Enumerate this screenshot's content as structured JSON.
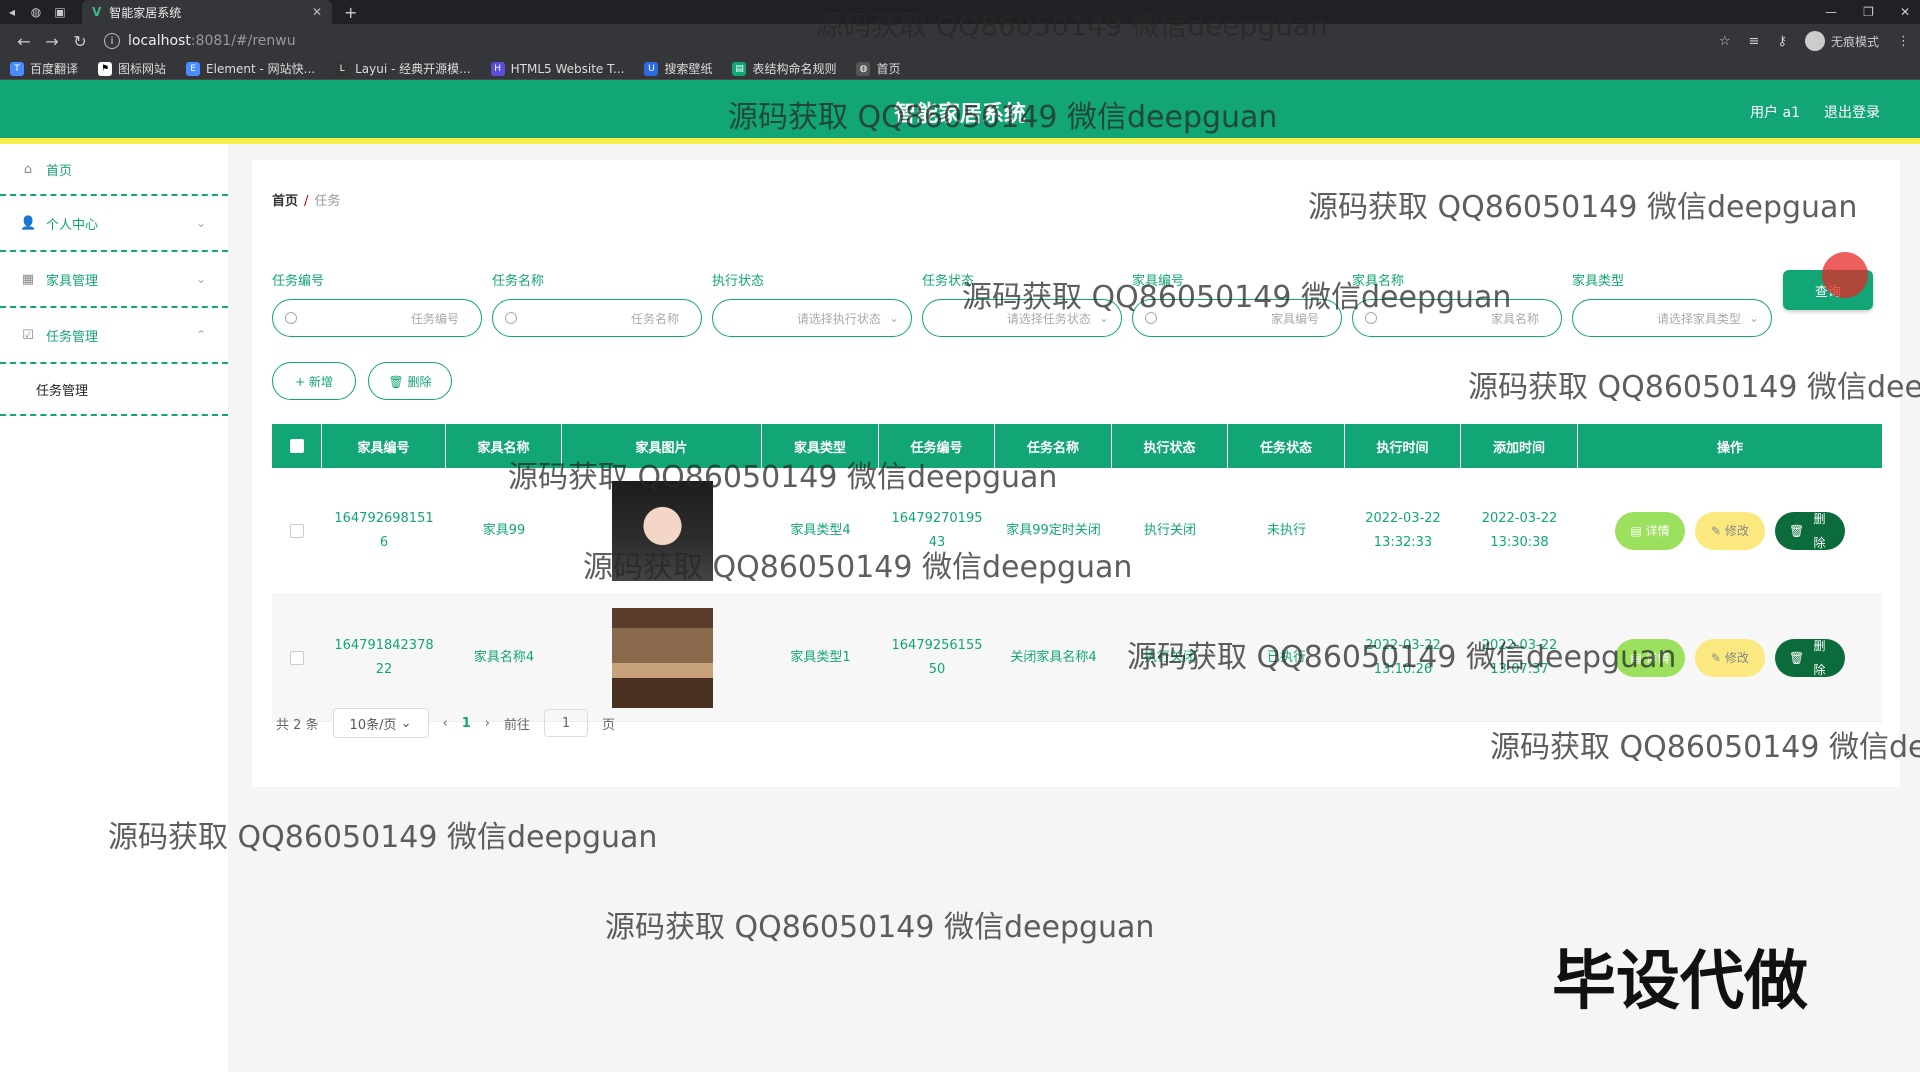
{
  "browser": {
    "tab_title": "智能家居系统",
    "url_host": "localhost",
    "url_rest": ":8081/#/renwu",
    "incognito_label": "无痕模式",
    "bookmarks": [
      "百度翻译",
      "图标网站",
      "Element - 网站快...",
      "Layui - 经典开源模...",
      "HTML5 Website T...",
      "搜索壁纸",
      "表结构命名规则",
      "首页"
    ]
  },
  "header": {
    "title": "智能家居系统",
    "user": "用户 a1",
    "logout": "退出登录"
  },
  "sidebar": {
    "items": [
      {
        "label": "首页",
        "icon": "home-icon"
      },
      {
        "label": "个人中心",
        "icon": "user-icon"
      },
      {
        "label": "家具管理",
        "icon": "grid-icon"
      },
      {
        "label": "任务管理",
        "icon": "task-icon"
      }
    ],
    "submenu": "任务管理"
  },
  "breadcrumb": {
    "home": "首页",
    "sep": "/",
    "current": "任务"
  },
  "search": {
    "fields": [
      {
        "label": "任务编号",
        "placeholder": "任务编号",
        "type": "input"
      },
      {
        "label": "任务名称",
        "placeholder": "任务名称",
        "type": "input"
      },
      {
        "label": "执行状态",
        "placeholder": "请选择执行状态",
        "type": "select"
      },
      {
        "label": "任务状态",
        "placeholder": "请选择任务状态",
        "type": "select"
      },
      {
        "label": "家具编号",
        "placeholder": "家具编号",
        "type": "input"
      },
      {
        "label": "家具名称",
        "placeholder": "家具名称",
        "type": "input"
      },
      {
        "label": "家具类型",
        "placeholder": "请选择家具类型",
        "type": "select"
      }
    ],
    "query_button": "查询"
  },
  "actions": {
    "add": "+ 新增",
    "delete": "🗑 删除"
  },
  "table": {
    "headers": [
      "家具编号",
      "家具名称",
      "家具图片",
      "家具类型",
      "任务编号",
      "任务名称",
      "执行状态",
      "任务状态",
      "执行时间",
      "添加时间",
      "操作"
    ],
    "rows": [
      {
        "furniture_no": "1647926981516",
        "furniture_name": "家具99",
        "furniture_type": "家具类型4",
        "task_no": "1647927019543",
        "task_name": "家具99定时关闭",
        "exec_status": "执行关闭",
        "task_status": "未执行",
        "exec_time": "2022-03-22 13:32:33",
        "add_time": "2022-03-22 13:30:38"
      },
      {
        "furniture_no": "164791842378 22",
        "furniture_name": "家具名称4",
        "furniture_type": "家具类型1",
        "task_no": "1647925615550",
        "task_name": "关闭家具名称4",
        "exec_status": "执行关闭",
        "task_status": "已执行",
        "exec_time": "2022-03-22 13:10:26",
        "add_time": "2022-03-22 13:07:37"
      }
    ],
    "op_labels": {
      "detail": "详情",
      "edit": "修改",
      "delete": "删除"
    }
  },
  "pager": {
    "total": "共 2 条",
    "size": "10条/页",
    "current_page": "1",
    "goto": "前往",
    "goto_value": "1",
    "unit": "页"
  },
  "watermark_text": "源码获取 QQ86050149 微信deepguan",
  "corner_text": "毕设代做",
  "colors": {
    "primary": "#12a576",
    "accent_bar": "#f5f04a",
    "detail": "#9be15d",
    "edit": "#fbe97f",
    "delete": "#0b6b3a"
  }
}
